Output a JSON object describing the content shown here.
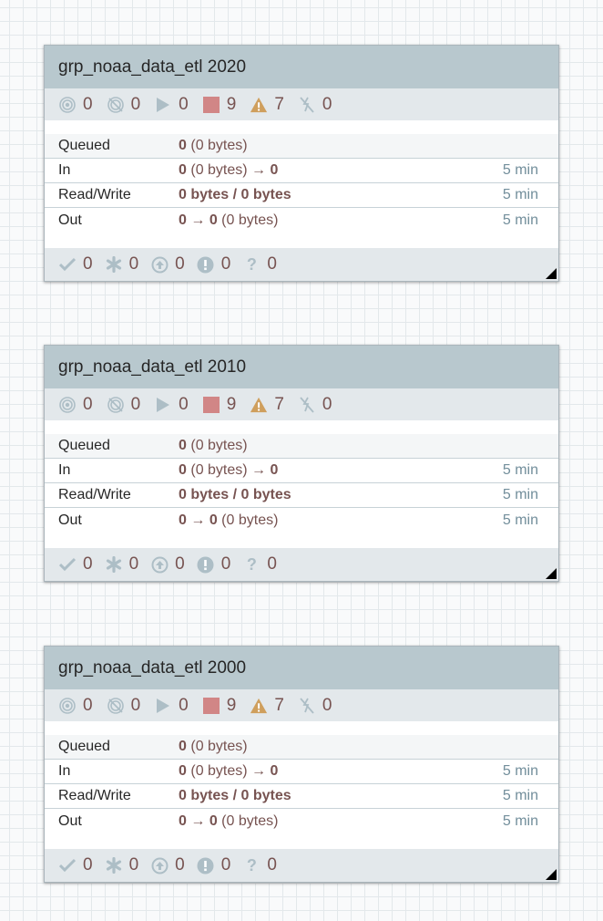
{
  "groups": [
    {
      "name": "grp_noaa_data_etl 2020",
      "stats": {
        "transmitting": "0",
        "not_transmitting": "0",
        "running": "0",
        "stopped": "9",
        "invalid": "7",
        "disabled": "0"
      },
      "rows": {
        "queued": {
          "label": "Queued",
          "count": "0",
          "rest": "(0 bytes)"
        },
        "in": {
          "label": "In",
          "count": "0",
          "mid": "(0 bytes) →",
          "to": "0",
          "time": "5 min"
        },
        "rw": {
          "label": "Read/Write",
          "value": "0 bytes / 0 bytes",
          "time": "5 min"
        },
        "out": {
          "label": "Out",
          "count": "0",
          "arrow": "→",
          "to": "0",
          "rest": "(0 bytes)",
          "time": "5 min"
        }
      },
      "footer": {
        "up_to_date": "0",
        "locally_modified": "0",
        "stale": "0",
        "sync_failure": "0",
        "unknown": "0"
      }
    },
    {
      "name": "grp_noaa_data_etl 2010",
      "stats": {
        "transmitting": "0",
        "not_transmitting": "0",
        "running": "0",
        "stopped": "9",
        "invalid": "7",
        "disabled": "0"
      },
      "rows": {
        "queued": {
          "label": "Queued",
          "count": "0",
          "rest": "(0 bytes)"
        },
        "in": {
          "label": "In",
          "count": "0",
          "mid": "(0 bytes) →",
          "to": "0",
          "time": "5 min"
        },
        "rw": {
          "label": "Read/Write",
          "value": "0 bytes / 0 bytes",
          "time": "5 min"
        },
        "out": {
          "label": "Out",
          "count": "0",
          "arrow": "→",
          "to": "0",
          "rest": "(0 bytes)",
          "time": "5 min"
        }
      },
      "footer": {
        "up_to_date": "0",
        "locally_modified": "0",
        "stale": "0",
        "sync_failure": "0",
        "unknown": "0"
      }
    },
    {
      "name": "grp_noaa_data_etl 2000",
      "stats": {
        "transmitting": "0",
        "not_transmitting": "0",
        "running": "0",
        "stopped": "9",
        "invalid": "7",
        "disabled": "0"
      },
      "rows": {
        "queued": {
          "label": "Queued",
          "count": "0",
          "rest": "(0 bytes)"
        },
        "in": {
          "label": "In",
          "count": "0",
          "mid": "(0 bytes) →",
          "to": "0",
          "time": "5 min"
        },
        "rw": {
          "label": "Read/Write",
          "value": "0 bytes / 0 bytes",
          "time": "5 min"
        },
        "out": {
          "label": "Out",
          "count": "0",
          "arrow": "→",
          "to": "0",
          "rest": "(0 bytes)",
          "time": "5 min"
        }
      },
      "footer": {
        "up_to_date": "0",
        "locally_modified": "0",
        "stale": "0",
        "sync_failure": "0",
        "unknown": "0"
      }
    }
  ],
  "colors": {
    "header_bg": "#b8c8ce",
    "stats_bg": "#e3e8eb",
    "value_text": "#775351",
    "stopped": "#d18686",
    "invalid": "#cf9f5d",
    "icon_gray": "#adbec6"
  }
}
